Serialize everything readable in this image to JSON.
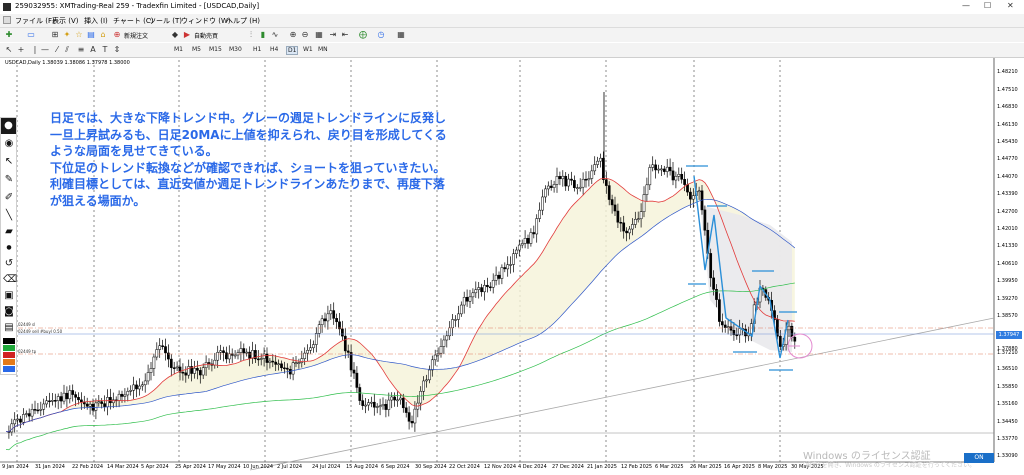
{
  "window": {
    "title": "259032955: XMTrading-Real 259 - Tradexfin Limited - [USDCAD,Daily]",
    "controls": [
      "—",
      "☐",
      "✕"
    ]
  },
  "menu": [
    "ファイル (F)",
    "表示 (V)",
    "挿入 (I)",
    "チャート (C)",
    "ツール (T)",
    "ウィンドウ (W)",
    "ヘルプ (H)"
  ],
  "toolbar": {
    "new_order": "新規注文",
    "auto_trading": "自動売買",
    "timeframes": [
      "M1",
      "M5",
      "M15",
      "M30",
      "H1",
      "H4",
      "D1",
      "W1",
      "MN"
    ]
  },
  "chart": {
    "symbol_info": "USDCAD,Daily  1.38039 1.38086 1.37978 1.38000",
    "current_price": "1.37947",
    "on_button": "ON",
    "hline_labels": [
      "02449 sl",
      "02449 sell #buyl 0.50",
      "02449 tp"
    ]
  },
  "annotation": {
    "lines": [
      "日足では、大きな下降トレンド中。グレーの週足トレンドラインに反発し",
      "一旦上昇試みるも、日足20MAに上値を抑えられ、戻り目を形成してくる",
      "ような局面を見せてきている。",
      "下位足のトレンド転換などが確認できれば、ショートを狙っていきたい。",
      "利確目標としては、直近安値か週足トレンドラインあたりまで、再度下落",
      "が狙える場面か。"
    ],
    "color": "#2a69e8"
  },
  "price_axis": [
    "1.48210",
    "1.47510",
    "1.46830",
    "1.46130",
    "1.45430",
    "1.44770",
    "1.44070",
    "1.43390",
    "1.42700",
    "1.42010",
    "1.41330",
    "1.40610",
    "1.39950",
    "1.39270",
    "1.38570",
    "1.37880",
    "1.37210",
    "1.36510",
    "1.35850",
    "1.35160",
    "1.34450",
    "1.33770",
    "1.33090"
  ],
  "date_axis": [
    "9 Jan 2024",
    "31 Jan 2024",
    "22 Feb 2024",
    "14 Mar 2024",
    "5 Apr 2024",
    "25 Apr 2024",
    "17 May 2024",
    "10 Jun 2024",
    "2 Jul 2024",
    "24 Jul 2024",
    "15 Aug 2024",
    "6 Sep 2024",
    "30 Sep 2024",
    "22 Oct 2024",
    "12 Nov 2024",
    "4 Dec 2024",
    "27 Dec 2024",
    "21 Jan 2025",
    "12 Feb 2025",
    "6 Mar 2025",
    "26 Mar 2025",
    "16 Apr 2025",
    "8 May 2025",
    "30 May 2025"
  ],
  "watermark": [
    "Windows のライセンス認証",
    "[設定] を開き、Windows のライセンス認証を行ってください。"
  ]
}
